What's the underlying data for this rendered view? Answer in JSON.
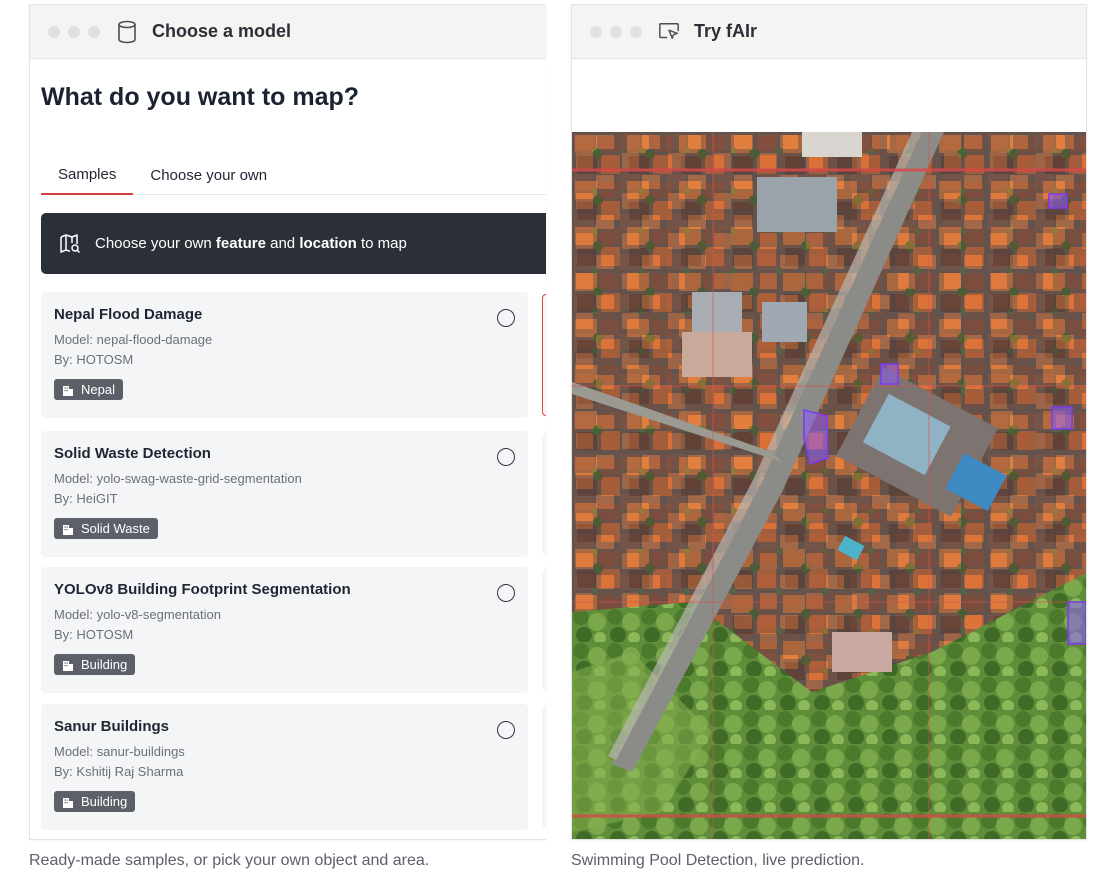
{
  "left_panel": {
    "window_title": "Choose a model",
    "heading": "What do you want to map?",
    "tabs": [
      {
        "label": "Samples",
        "active": true
      },
      {
        "label": "Choose your own",
        "active": false
      }
    ],
    "banner": {
      "prefix": "Choose your own ",
      "feature": "feature",
      "and": " and ",
      "location": "location",
      "suffix": " to map"
    },
    "cards": [
      {
        "title": "Nepal Flood Damage",
        "model": "Model: nepal-flood-damage",
        "by": "By: HOTOSM",
        "tag": "Nepal",
        "selected": false
      },
      {
        "title": "Solid Waste Detection",
        "model": "Model: yolo-swag-waste-grid-segmentation",
        "by": "By: HeiGIT",
        "tag": "Solid Waste",
        "selected": false
      },
      {
        "title": "YOLOv8 Building Footprint Segmentation",
        "model": "Model: yolo-v8-segmentation",
        "by": "By: HOTOSM",
        "tag": "Building",
        "selected": false
      },
      {
        "title": "Sanur Buildings",
        "model": "Model: sanur-buildings",
        "by": "By: Kshitij Raj Sharma",
        "tag": "Building",
        "selected": false
      }
    ],
    "caption": "Ready-made samples, or pick your own object and area."
  },
  "right_panel": {
    "window_title": "Try fAIr",
    "caption": "Swimming Pool Detection, live prediction."
  },
  "colors": {
    "accent": "#d63f3f",
    "banner_bg": "#2a2f38",
    "tag_bg": "#5d6068",
    "card_bg": "#f4f5f7",
    "titlebar_bg": "#f5f4f2",
    "prediction": "#8b5cf6"
  },
  "icons": {
    "left_titlebar": "database-icon",
    "right_titlebar": "cursor-monitor-icon",
    "banner": "map-search-icon",
    "tag": "building-icon"
  }
}
